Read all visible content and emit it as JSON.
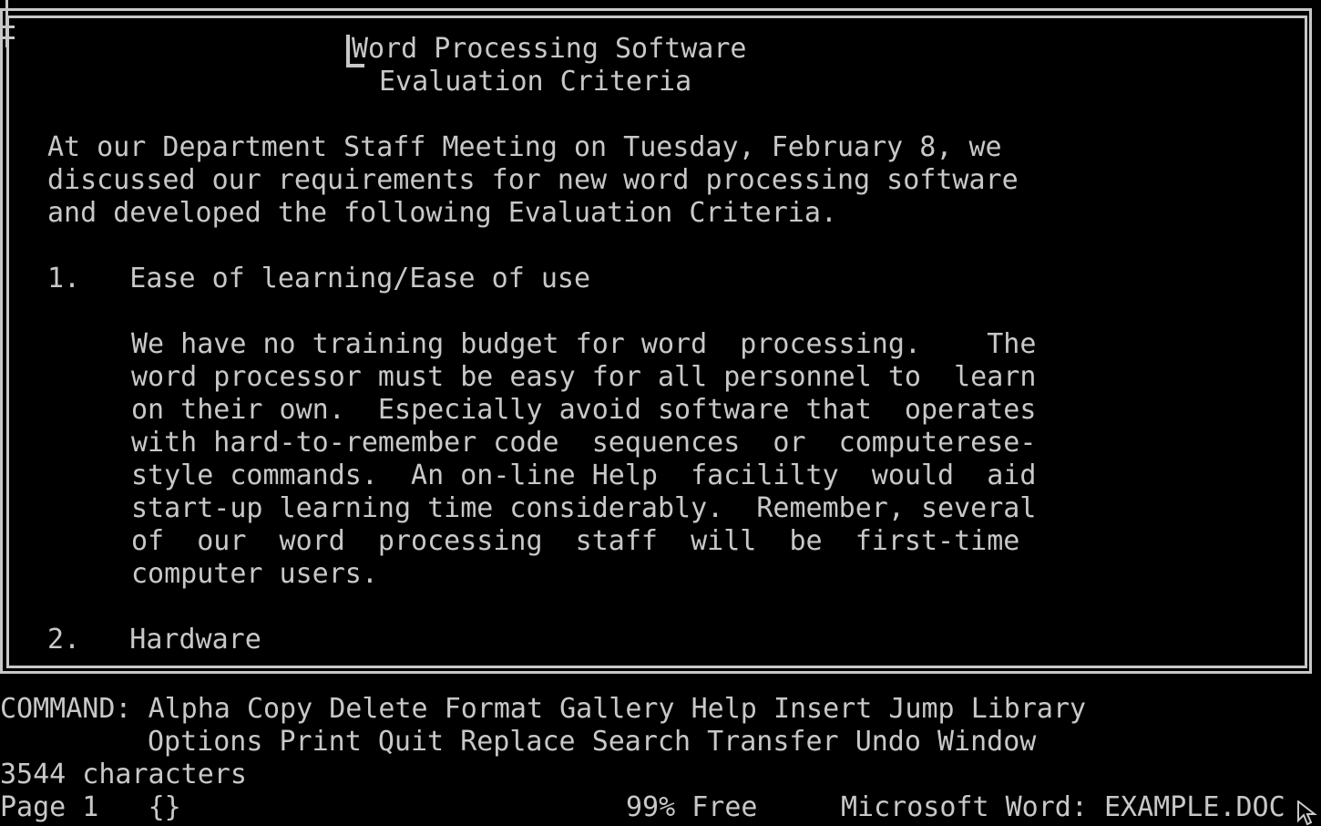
{
  "document": {
    "title_line1": "Word Processing Software",
    "title_line2": "Evaluation Criteria",
    "lines": [
      "At our Department Staff Meeting on Tuesday, February 8, we",
      "discussed our requirements for new word processing software",
      "and developed the following Evaluation Criteria.",
      "1.   Ease of learning/Ease of use",
      "We have no training budget for word  processing.    The",
      "word processor must be easy for all personnel to  learn",
      "on their own.  Especially avoid software that  operates",
      "with hard-to-remember code  sequences  or  computerese-",
      "style commands.  An on-line Help  facililty  would  aid",
      "start-up learning time considerably.  Remember, several",
      "of  our  word  processing  staff  will  be  first-time",
      "computer users.",
      "2.   Hardware"
    ]
  },
  "command": {
    "label": "COMMAND:",
    "items_row1": [
      "Alpha",
      "Copy",
      "Delete",
      "Format",
      "Gallery",
      "Help",
      "Insert",
      "Jump",
      "Library"
    ],
    "items_row2": [
      "Options",
      "Print",
      "Quit",
      "Replace",
      "Search",
      "Transfer",
      "Undo",
      "Window"
    ]
  },
  "status": {
    "characters": "3544 characters",
    "page": "Page 1",
    "braces": "{}",
    "free": "99% Free",
    "app": "Microsoft Word: EXAMPLE.DOC"
  },
  "colors": {
    "background": "#000000",
    "foreground": "#c8c8c8"
  },
  "icons": {
    "mouse_pointer": "arrow-cursor-icon"
  }
}
